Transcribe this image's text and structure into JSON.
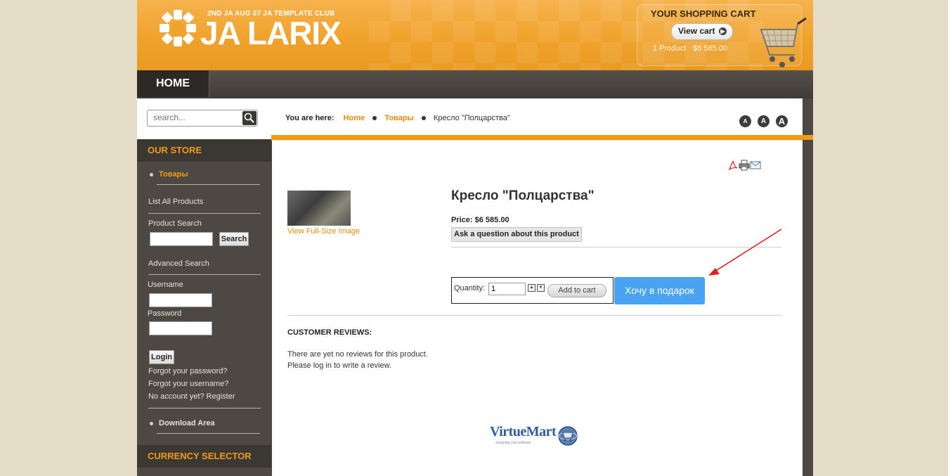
{
  "header": {
    "logo_subtitle": "2ND JA AUG 07 JA TEMPLATE CLUB",
    "logo_title": "JA LARIX",
    "cart": {
      "title": "YOUR SHOPPING CART",
      "view_cart_label": "View cart",
      "product_count": "1 Product",
      "total": "$6 585.00"
    }
  },
  "nav": {
    "home_label": "HOME"
  },
  "sidebar": {
    "search_placeholder": "search...",
    "our_store_heading": "OUR STORE",
    "category_item": "Товары",
    "list_all_products": "List All Products",
    "product_search_label": "Product Search",
    "search_button": "Search",
    "advanced_search": "Advanced Search",
    "username_label": "Username",
    "password_label": "Password",
    "login_button": "Login",
    "forgot_password": "Forgot your password?",
    "forgot_username": "Forgot your username?",
    "register": "No account yet? Register",
    "download_area": "Download Area",
    "currency_heading": "CURRENCY SELECTOR"
  },
  "breadcrumb": {
    "label": "You are here:",
    "items": [
      "Home",
      "Товары",
      "Кресло \"Полцарства\""
    ]
  },
  "font_size_buttons": [
    "A",
    "A",
    "A"
  ],
  "product": {
    "title": "Кресло \"Полцарства\"",
    "view_full_size": "View Full-Size Image",
    "price": "Price: $6 585.00",
    "ask_question": "Ask a question about this product",
    "quantity_label": "Quantity:",
    "quantity_value": "1",
    "add_to_cart": "Add to cart",
    "gift_button": "Хочу в подарок"
  },
  "reviews": {
    "heading": "CUSTOMER REVIEWS:",
    "line1": "There are yet no reviews for this product.",
    "line2": "Please log in to write a review."
  },
  "footer_logo": {
    "text": "VirtueMart",
    "tagline": "shopping cart software"
  },
  "colors": {
    "accent_orange": "#f39c12",
    "sidebar_bg": "#4d4843",
    "gift_button": "#4aa3f0",
    "annotation_arrow": "#e02020"
  }
}
